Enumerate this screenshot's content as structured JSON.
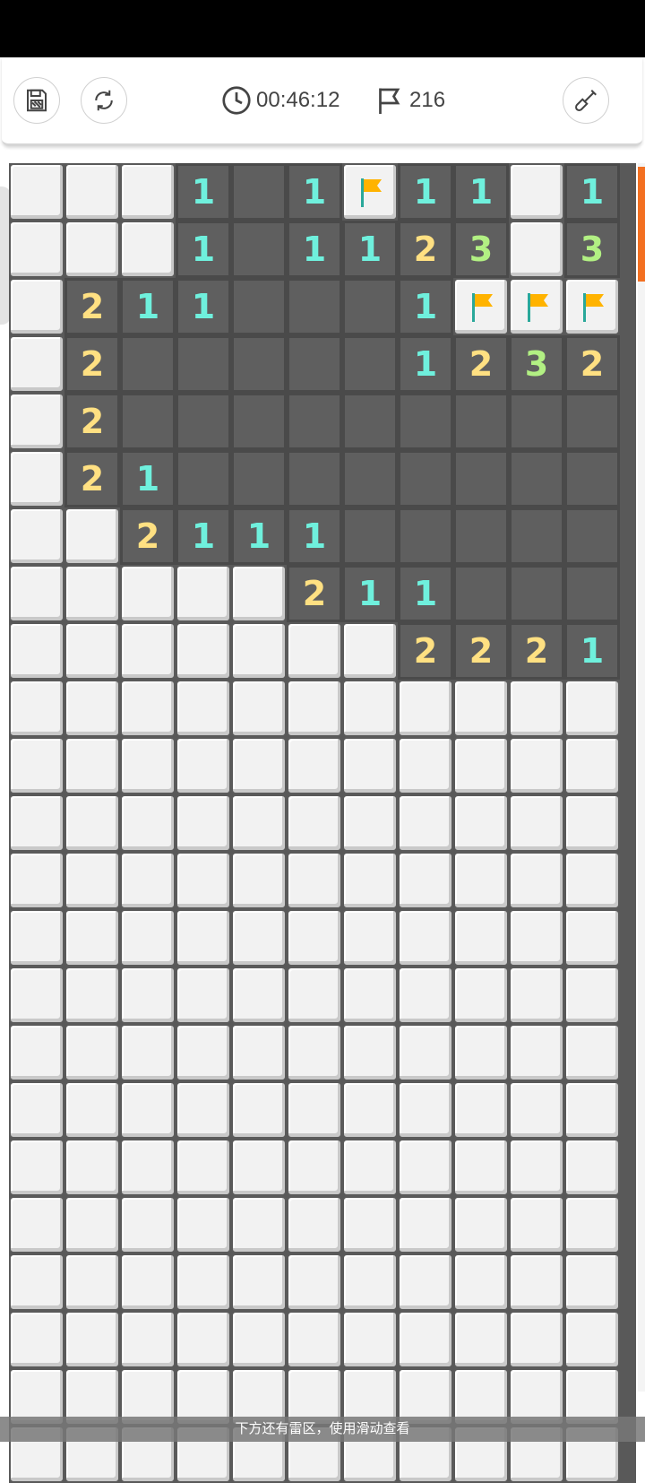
{
  "toolbar": {
    "timer": "00:46:12",
    "flags_remaining": "216",
    "icons": [
      "save-icon",
      "restart-icon",
      "clock-icon",
      "flag-icon",
      "shovel-icon"
    ]
  },
  "board": {
    "cols": 11,
    "rows_visible": 23,
    "rows": [
      [
        "H",
        "H",
        "H",
        "1",
        "0",
        "1",
        "F",
        "1",
        "1",
        "H",
        "1"
      ],
      [
        "H",
        "H",
        "H",
        "1",
        "0",
        "1",
        "1",
        "2",
        "3",
        "H",
        "3"
      ],
      [
        "H",
        "2",
        "1",
        "1",
        "0",
        "0",
        "0",
        "1",
        "F",
        "F",
        "F"
      ],
      [
        "H",
        "2",
        "0",
        "0",
        "0",
        "0",
        "0",
        "1",
        "2",
        "3",
        "2"
      ],
      [
        "H",
        "2",
        "0",
        "0",
        "0",
        "0",
        "0",
        "0",
        "0",
        "0",
        "0"
      ],
      [
        "H",
        "2",
        "1",
        "0",
        "0",
        "0",
        "0",
        "0",
        "0",
        "0",
        "0"
      ],
      [
        "H",
        "H",
        "2",
        "1",
        "1",
        "1",
        "0",
        "0",
        "0",
        "0",
        "0"
      ],
      [
        "H",
        "H",
        "H",
        "H",
        "H",
        "2",
        "1",
        "1",
        "0",
        "0",
        "0"
      ],
      [
        "H",
        "H",
        "H",
        "H",
        "H",
        "H",
        "H",
        "2",
        "2",
        "2",
        "1"
      ],
      [
        "H",
        "H",
        "H",
        "H",
        "H",
        "H",
        "H",
        "H",
        "H",
        "H",
        "H"
      ],
      [
        "H",
        "H",
        "H",
        "H",
        "H",
        "H",
        "H",
        "H",
        "H",
        "H",
        "H"
      ],
      [
        "H",
        "H",
        "H",
        "H",
        "H",
        "H",
        "H",
        "H",
        "H",
        "H",
        "H"
      ],
      [
        "H",
        "H",
        "H",
        "H",
        "H",
        "H",
        "H",
        "H",
        "H",
        "H",
        "H"
      ],
      [
        "H",
        "H",
        "H",
        "H",
        "H",
        "H",
        "H",
        "H",
        "H",
        "H",
        "H"
      ],
      [
        "H",
        "H",
        "H",
        "H",
        "H",
        "H",
        "H",
        "H",
        "H",
        "H",
        "H"
      ],
      [
        "H",
        "H",
        "H",
        "H",
        "H",
        "H",
        "H",
        "H",
        "H",
        "H",
        "H"
      ],
      [
        "H",
        "H",
        "H",
        "H",
        "H",
        "H",
        "H",
        "H",
        "H",
        "H",
        "H"
      ],
      [
        "H",
        "H",
        "H",
        "H",
        "H",
        "H",
        "H",
        "H",
        "H",
        "H",
        "H"
      ],
      [
        "H",
        "H",
        "H",
        "H",
        "H",
        "H",
        "H",
        "H",
        "H",
        "H",
        "H"
      ],
      [
        "H",
        "H",
        "H",
        "H",
        "H",
        "H",
        "H",
        "H",
        "H",
        "H",
        "H"
      ],
      [
        "H",
        "H",
        "H",
        "H",
        "H",
        "H",
        "H",
        "H",
        "H",
        "H",
        "H"
      ],
      [
        "H",
        "H",
        "H",
        "H",
        "H",
        "H",
        "H",
        "H",
        "H",
        "H",
        "H"
      ],
      [
        "H",
        "H",
        "H",
        "H",
        "H",
        "H",
        "H",
        "H",
        "H",
        "H",
        "H"
      ]
    ]
  },
  "colors": {
    "num1": "#6ff0dd",
    "num2": "#ffe082",
    "num3": "#b2f083",
    "flag": "#ffb300",
    "scroll_thumb": "#f37021"
  },
  "hint": "下方还有雷区，使用滑动查看"
}
